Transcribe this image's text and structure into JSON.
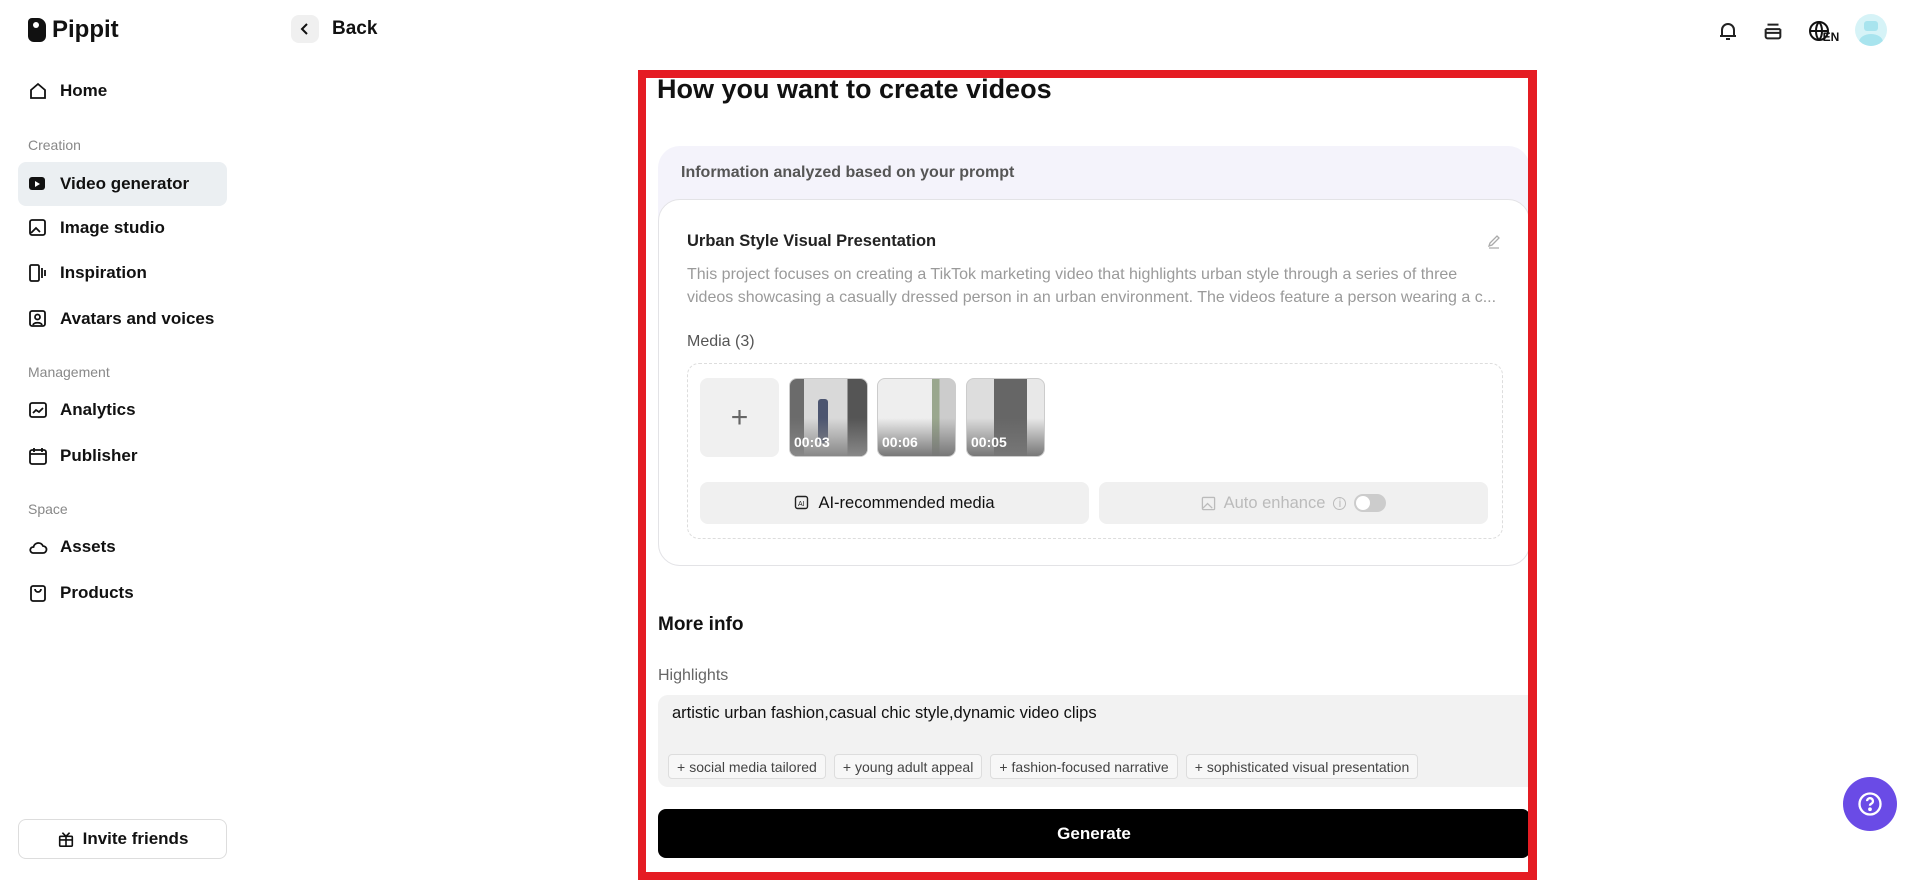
{
  "app": {
    "name": "Pippit"
  },
  "header": {
    "back_label": "Back",
    "language": "EN"
  },
  "sidebar": {
    "home": "Home",
    "sections": [
      {
        "label": "Creation",
        "items": [
          "Video generator",
          "Image studio",
          "Inspiration",
          "Avatars and voices"
        ]
      },
      {
        "label": "Management",
        "items": [
          "Analytics",
          "Publisher"
        ]
      },
      {
        "label": "Space",
        "items": [
          "Assets",
          "Products"
        ]
      }
    ],
    "active": "Video generator",
    "invite": "Invite friends"
  },
  "main": {
    "title": "How you want to create videos",
    "panel_header": "Information analyzed based on your prompt",
    "card_title": "Urban Style Visual Presentation",
    "description": "This project focuses on creating a TikTok marketing video that highlights urban style through a series of three videos showcasing a casually dressed person in an urban environment. The videos feature a person wearing a c...",
    "media_label": "Media (3)",
    "media": [
      {
        "duration": "00:03"
      },
      {
        "duration": "00:06"
      },
      {
        "duration": "00:05"
      }
    ],
    "ai_media_button": "AI-recommended media",
    "auto_enhance": "Auto enhance",
    "auto_enhance_on": false,
    "more_info": "More info",
    "highlights_label": "Highlights",
    "highlights_value": "artistic urban fashion,casual chic style,dynamic video clips",
    "suggestions": [
      "social media tailored",
      "young adult appeal",
      "fashion-focused narrative",
      "sophisticated visual presentation"
    ],
    "generate": "Generate"
  },
  "colors": {
    "accent": "#6a4be6",
    "highlight_border": "#e51c23"
  }
}
